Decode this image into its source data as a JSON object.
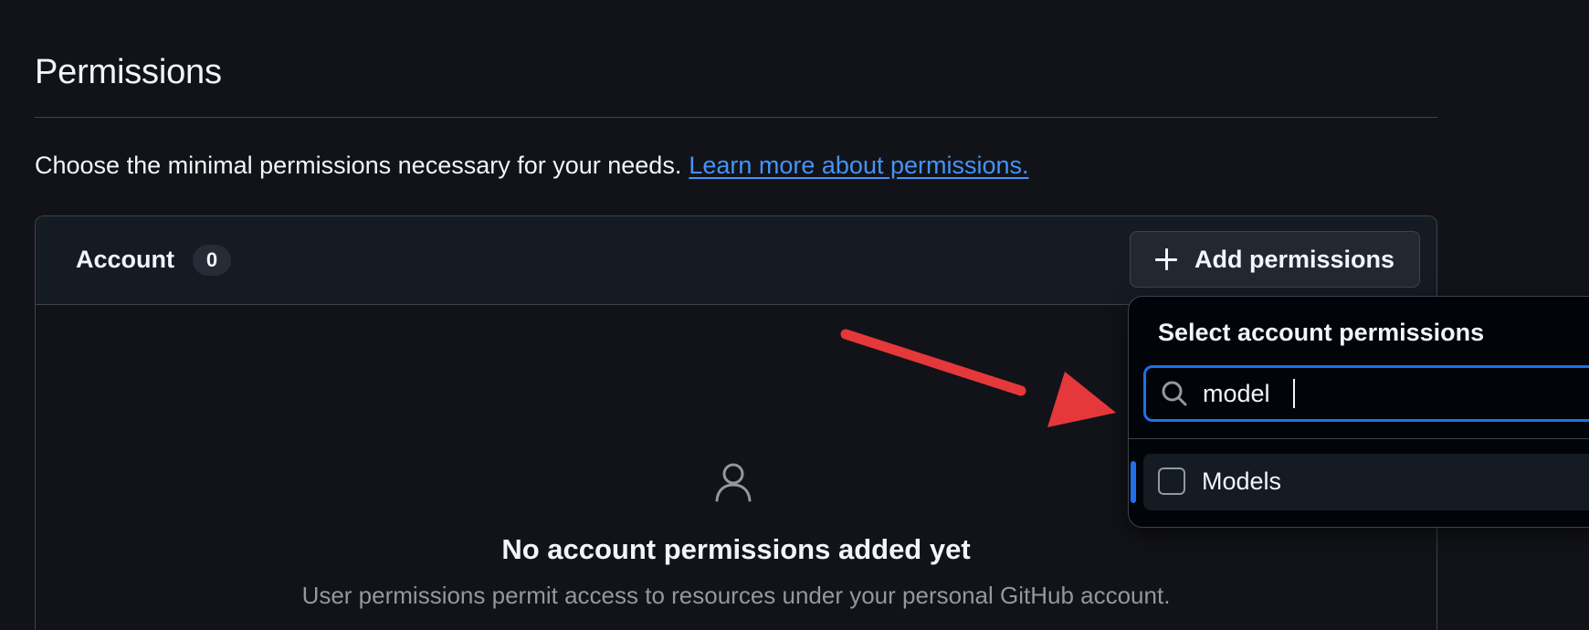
{
  "section": {
    "title": "Permissions",
    "description": "Choose the minimal permissions necessary for your needs.",
    "learn_more_link": "Learn more about permissions."
  },
  "account": {
    "label": "Account",
    "count": "0",
    "add_button_label": "Add permissions",
    "empty_state": {
      "icon": "person-icon",
      "title": "No account permissions added yet",
      "subtitle": "User permissions permit access to resources under your personal GitHub account."
    }
  },
  "dropdown": {
    "title": "Select account permissions",
    "search_value": "model",
    "options": [
      {
        "label": "Models",
        "checked": false
      }
    ]
  },
  "colors": {
    "accent": "#1f6feb",
    "link": "#4493f8",
    "annotation_arrow": "#e5383b"
  }
}
